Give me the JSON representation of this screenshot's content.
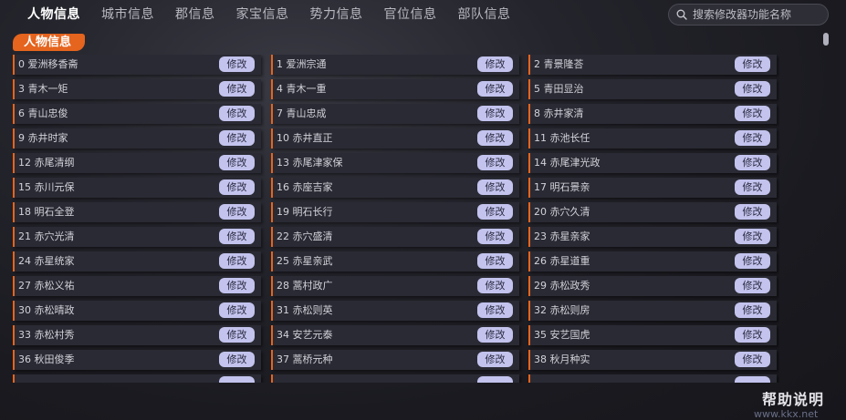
{
  "nav": {
    "tabs": [
      {
        "label": "人物信息",
        "active": true
      },
      {
        "label": "城市信息",
        "active": false
      },
      {
        "label": "郡信息",
        "active": false
      },
      {
        "label": "家宝信息",
        "active": false
      },
      {
        "label": "势力信息",
        "active": false
      },
      {
        "label": "官位信息",
        "active": false
      },
      {
        "label": "部队信息",
        "active": false
      }
    ]
  },
  "search": {
    "placeholder": "搜索修改器功能名称"
  },
  "section": {
    "title": "人物信息"
  },
  "edit_label": "修改",
  "characters": [
    "0 爱洲移香斋",
    "1 爱洲宗通",
    "2 青景隆荅",
    "3 青木一矩",
    "4 青木一重",
    "5 青田显治",
    "6 青山忠俊",
    "7 青山忠成",
    "8 赤井家清",
    "9 赤井时家",
    "10 赤井直正",
    "11 赤池长任",
    "12 赤尾清纲",
    "13 赤尾津家保",
    "14 赤尾津光政",
    "15 赤川元保",
    "16 赤座吉家",
    "17 明石景亲",
    "18 明石全登",
    "19 明石长行",
    "20 赤穴久清",
    "21 赤穴光清",
    "22 赤穴盛清",
    "23 赤星亲家",
    "24 赤星统家",
    "25 赤星亲武",
    "26 赤星道重",
    "27 赤松义祐",
    "28 蒿村政广",
    "29 赤松政秀",
    "30 赤松晴政",
    "31 赤松则英",
    "32 赤松则房",
    "33 赤松村秀",
    "34 安艺元泰",
    "35 安艺国虎",
    "36 秋田俊季",
    "37 蒿桥元种",
    "38 秋月种实"
  ],
  "help": {
    "label": "帮助说明"
  },
  "watermark": "www.kkx.net",
  "colors": {
    "accent": "#e5641e",
    "button": "#c3c3ee",
    "row_bg": "#2a2a34"
  }
}
